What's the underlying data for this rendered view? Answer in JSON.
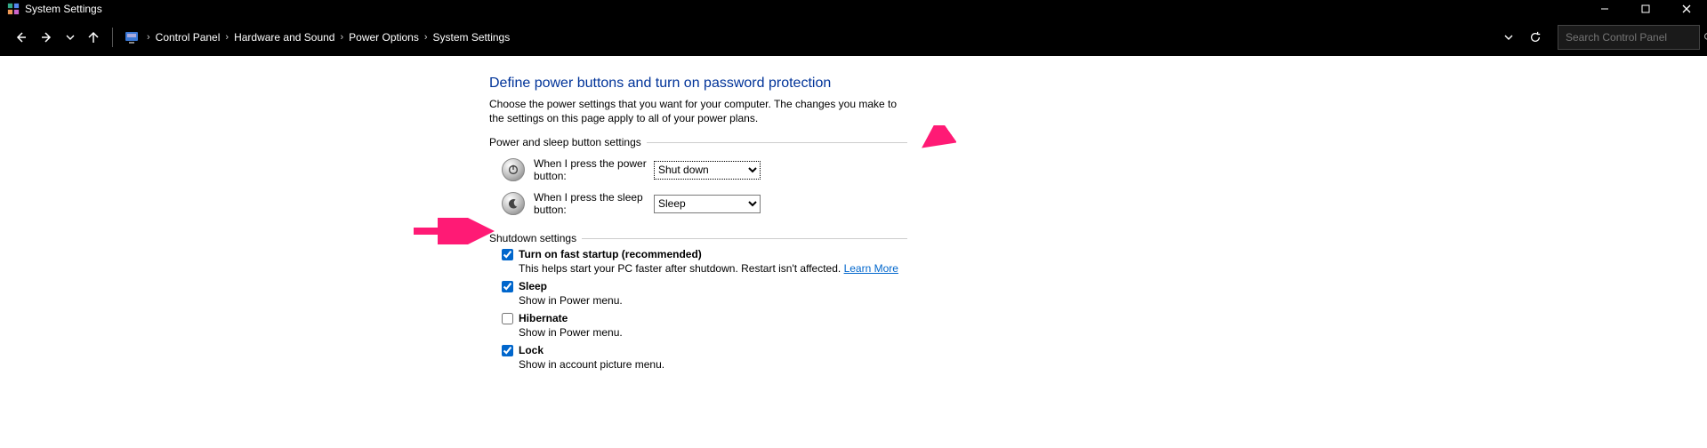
{
  "window": {
    "title": "System Settings"
  },
  "breadcrumb": {
    "root": "Control Panel",
    "path1": "Hardware and Sound",
    "path2": "Power Options",
    "path3": "System Settings"
  },
  "search": {
    "placeholder": "Search Control Panel"
  },
  "page": {
    "heading": "Define power buttons and turn on password protection",
    "description": "Choose the power settings that you want for your computer. The changes you make to the settings on this page apply to all of your power plans.",
    "group1_legend": "Power and sleep button settings",
    "power_button_label": "When I press the power button:",
    "power_button_value": "Shut down",
    "sleep_button_label": "When I press the sleep button:",
    "sleep_button_value": "Sleep",
    "group2_legend": "Shutdown settings",
    "shutdown": {
      "fast": {
        "title": "Turn on fast startup (recommended)",
        "sub_a": "This helps start your PC faster after shutdown. Restart isn't affected. ",
        "link": "Learn More"
      },
      "sleep": {
        "title": "Sleep",
        "sub": "Show in Power menu."
      },
      "hibernate": {
        "title": "Hibernate",
        "sub": "Show in Power menu."
      },
      "lock": {
        "title": "Lock",
        "sub": "Show in account picture menu."
      }
    }
  }
}
